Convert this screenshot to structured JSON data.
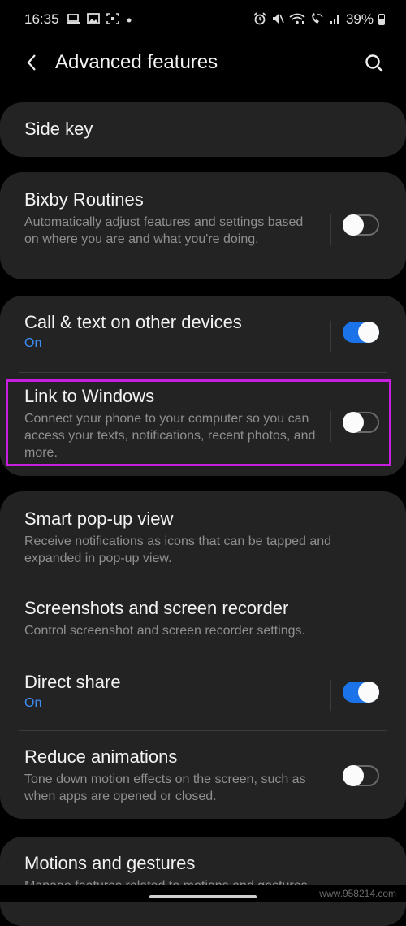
{
  "status_bar": {
    "time": "16:35",
    "left_icons": [
      "laptop-icon",
      "gallery-icon",
      "screenshot-icon",
      "dot-icon"
    ],
    "right_icons": [
      "alarm-icon",
      "mute-icon",
      "wifi-icon",
      "wifi-calling-icon",
      "signal-icon"
    ],
    "battery": "39%"
  },
  "header": {
    "title": "Advanced features",
    "back_icon": "back-chevron-icon",
    "search_icon": "search-icon"
  },
  "groups": [
    {
      "items": [
        {
          "title": "Side key"
        }
      ]
    },
    {
      "items": [
        {
          "title": "Bixby Routines",
          "desc": "Automatically adjust features and settings based on where you are and what you're doing.",
          "toggle": false
        }
      ]
    },
    {
      "items": [
        {
          "title": "Call & text on other devices",
          "status": "On",
          "toggle": true
        },
        {
          "title": "Link to Windows",
          "desc": "Connect your phone to your computer so you can access your texts, notifications, recent photos, and more.",
          "toggle": false,
          "highlighted": true
        }
      ]
    },
    {
      "items": [
        {
          "title": "Smart pop-up view",
          "desc": "Receive notifications as icons that can be tapped and expanded in pop-up view."
        },
        {
          "title": "Screenshots and screen recorder",
          "desc": "Control screenshot and screen recorder settings."
        },
        {
          "title": "Direct share",
          "status": "On",
          "toggle": true
        },
        {
          "title": "Reduce animations",
          "desc": "Tone down motion effects on the screen, such as when apps are opened or closed.",
          "toggle": false
        }
      ]
    },
    {
      "items": [
        {
          "title": "Motions and gestures",
          "desc": "Manage features related to motions and gestures."
        }
      ]
    }
  ],
  "colors": {
    "accent": "#1a73e8",
    "status_on": "#3e8ef7",
    "highlight": "#c71fe0",
    "card": "#232323",
    "background": "#000000"
  },
  "watermark": "www.958214.com"
}
